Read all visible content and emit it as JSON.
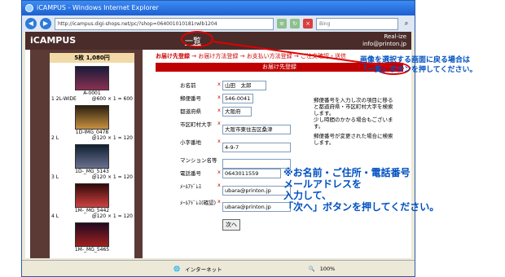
{
  "browser": {
    "title": "iCAMPUS - Windows Internet Explorer",
    "url": "http://icampus.digi-shops.net/pc/?shop=064001010181rwlb1204",
    "search_placeholder": "Bing",
    "status_text": "インターネット",
    "zoom": "100%"
  },
  "header": {
    "logo": "iCAMPUS",
    "list_link": "一覧",
    "company": "Real-ize",
    "email": "info@printon.jp"
  },
  "sidebar": {
    "heading": "5枚 1,080円",
    "items": [
      {
        "name": "A-0001",
        "size": "1 2L-WIDE",
        "price": "@600 × 1 = 600"
      },
      {
        "name": "1D-IMG_0478",
        "size": "2 L",
        "price": "@120 × 1 = 120"
      },
      {
        "name": "1D-_MG_5143",
        "size": "3 L",
        "price": "@120 × 1 = 120"
      },
      {
        "name": "1M-_MG_5442",
        "size": "4 L",
        "price": "@120 × 1 = 120"
      },
      {
        "name": "1M-_MG_5465",
        "size": "",
        "price": ""
      }
    ]
  },
  "steps": {
    "s1": "お届け先登録",
    "arrow": "→",
    "s2": "お届け方法登録",
    "s3": "お支払い方法登録",
    "s4": "ご注文確認・送信"
  },
  "form": {
    "section_title": "お届け先登録",
    "fields": [
      {
        "label": "お名前",
        "value": "山田　太郎"
      },
      {
        "label": "郵便番号",
        "value": "546-0041"
      },
      {
        "label": "都道府県",
        "value": "大阪府"
      },
      {
        "label": "市区町村大字",
        "value": "大阪市東住吉区桑津"
      },
      {
        "label": "小字番地",
        "value": "4-9-7"
      },
      {
        "label": "マンション名等",
        "value": ""
      },
      {
        "label": "電話番号",
        "value": "0643011559"
      },
      {
        "label": "ﾒｰﾙｱﾄﾞﾚｽ",
        "value": "ubara@printon.jp"
      },
      {
        "label": "ﾒｰﾙｱﾄﾞﾚｽ(確認)",
        "value": "ubara@printon.jp"
      }
    ],
    "required_mark": "x",
    "next_button": "次へ"
  },
  "notes": {
    "line1": "郵便番号を入力し次の項目に移ると都道府県・市区町村大字を検索します。",
    "line2": "少し時間のかかる場合もございます。",
    "line3": "郵便番号が変更された場合に検索します。"
  },
  "annotations": {
    "a1_line1": "画像を選択する画面に戻る場合は",
    "a1_line2": "「一覧」ボタンを押してください。",
    "a2_line1": "※お名前・ご住所・電話番号",
    "a2_line2": "メールアドレスを",
    "a2_line3": "入力して、",
    "a2_line4": "「次へ」ボタンを押してください。"
  },
  "colors": {
    "accent": "#c00000",
    "annotation": "#0050c0",
    "highlight": "#e00000"
  }
}
